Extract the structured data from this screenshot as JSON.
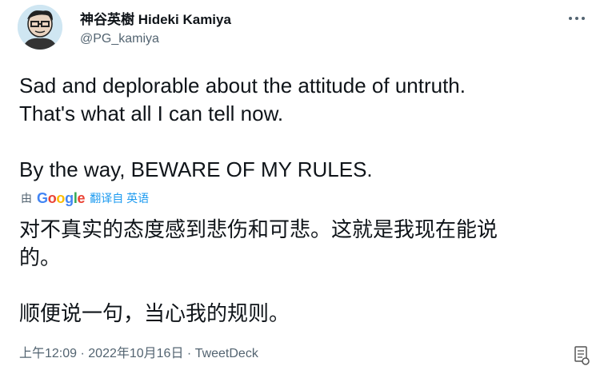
{
  "author": {
    "name": "神谷英樹 Hideki Kamiya",
    "handle": "@PG_kamiya"
  },
  "tweet": {
    "lines": [
      "Sad and deplorable about the attitude of untruth.",
      "That's what all I can tell now."
    ],
    "line_after_gap": "By the way, BEWARE OF MY RULES."
  },
  "translation": {
    "prefix": "由",
    "provider_letters": [
      {
        "ch": "G",
        "color": "#4285F4"
      },
      {
        "ch": "o",
        "color": "#EA4335"
      },
      {
        "ch": "o",
        "color": "#FBBC05"
      },
      {
        "ch": "g",
        "color": "#4285F4"
      },
      {
        "ch": "l",
        "color": "#34A853"
      },
      {
        "ch": "e",
        "color": "#EA4335"
      }
    ],
    "link": "翻译自 英语",
    "lines": [
      "对不真实的态度感到悲伤和可悲。这就是我现在能说",
      "的。"
    ],
    "line_after_gap": "顺便说一句，当心我的规则。"
  },
  "meta": {
    "time": "上午12:09",
    "separator1": " · ",
    "date": "2022年10月16日",
    "separator2": " · ",
    "source": "TweetDeck"
  },
  "icons": {
    "more": "more-options-icon",
    "avatar": "avatar",
    "corner": "document-icon"
  }
}
